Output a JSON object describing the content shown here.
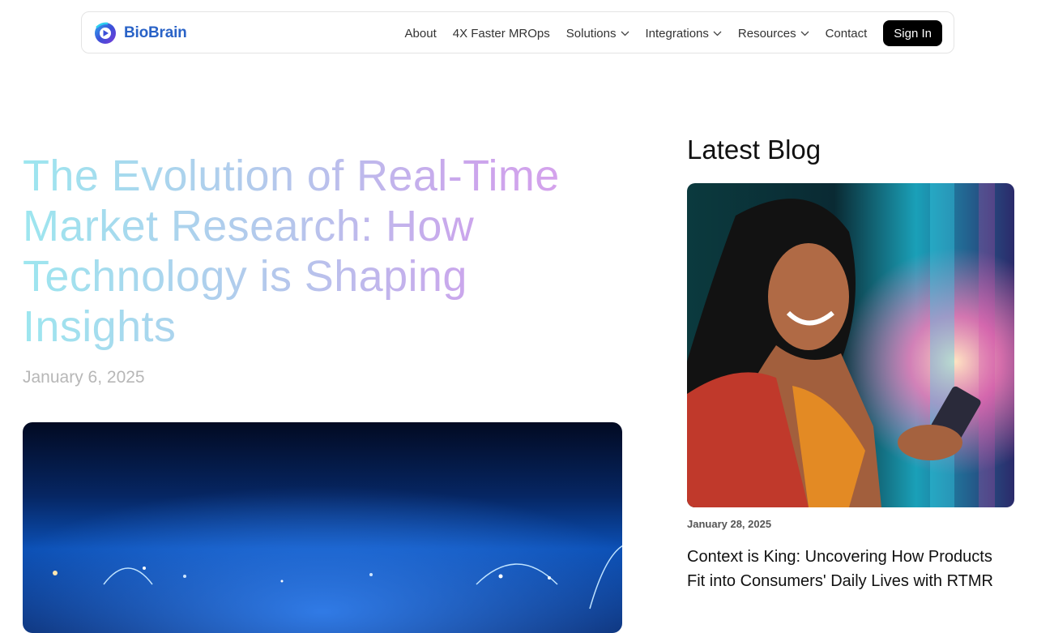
{
  "brand": {
    "name": "BioBrain",
    "accent": "#2a63c7"
  },
  "nav": {
    "items": [
      {
        "label": "About",
        "dropdown": false
      },
      {
        "label": "4X Faster MROps",
        "dropdown": false
      },
      {
        "label": "Solutions",
        "dropdown": true
      },
      {
        "label": "Integrations",
        "dropdown": true
      },
      {
        "label": "Resources",
        "dropdown": true
      },
      {
        "label": "Contact",
        "dropdown": false
      }
    ],
    "signin_label": "Sign In"
  },
  "article": {
    "title": "The Evolution of Real-Time Market Research: How Technology is Shaping Insights",
    "date": "January 6, 2025"
  },
  "sidebar": {
    "heading": "Latest Blog",
    "post": {
      "date": "January 28, 2025",
      "title": "Context is King: Uncovering How Products Fit into Consumers' Daily Lives with RTMR"
    }
  }
}
